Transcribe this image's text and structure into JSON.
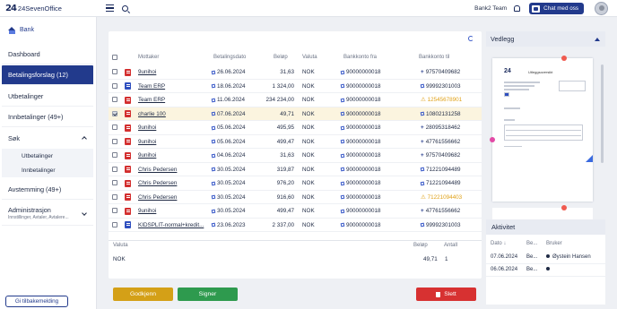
{
  "app": {
    "logo_mark": "24",
    "logo_text": "24SevenOffice"
  },
  "topbar": {
    "team": "Bank2 Team",
    "chat_label": "Chat med oss"
  },
  "sidebar": {
    "header": "Bank",
    "items": [
      {
        "label": "Dashboard"
      },
      {
        "label": "Betalingsforslag (12)"
      },
      {
        "label": "Utbetalinger"
      },
      {
        "label": "Innbetalinger (49+)"
      },
      {
        "label": "Søk"
      },
      {
        "label": "Avstemming (49+)"
      },
      {
        "label": "Administrasjon"
      }
    ],
    "sok_sub": [
      "Utbetalinger",
      "Innbetalinger"
    ],
    "admin_sub": "Innstillinger, Avtaler, Avtalere...",
    "feedback": "Gi tilbakemelding"
  },
  "table": {
    "headers": {
      "mottaker": "Mottaker",
      "dato": "Betalingsdato",
      "belop": "Beløp",
      "valuta": "Valuta",
      "fra": "Bankkonto fra",
      "til": "Bankkonto til"
    },
    "rows": [
      {
        "icon": "pdf",
        "mottaker": "9unihoi",
        "dato": "26.06.2024",
        "belop": "31,63",
        "valuta": "NOK",
        "fra": "90000000018",
        "til": "97570409682",
        "til_icon": "plus"
      },
      {
        "icon": "ehf",
        "mottaker": "Team ERP",
        "dato": "18.06.2024",
        "belop": "1 324,00",
        "valuta": "NOK",
        "fra": "90000000018",
        "til": "99992301003",
        "til_icon": "edit"
      },
      {
        "icon": "pdf",
        "mottaker": "Team ERP",
        "dato": "11.06.2024",
        "belop": "234 234,00",
        "valuta": "NOK",
        "fra": "90000000018",
        "til": "12545678901",
        "til_icon": "warn"
      },
      {
        "icon": "pdf",
        "mottaker": "charlie 100",
        "dato": "07.06.2024",
        "belop": "49,71",
        "valuta": "NOK",
        "fra": "90000000018",
        "til": "10802131258",
        "til_icon": "edit",
        "selected": true
      },
      {
        "icon": "pdf",
        "mottaker": "9unihoi",
        "dato": "05.06.2024",
        "belop": "495,95",
        "valuta": "NOK",
        "fra": "90000000018",
        "til": "28095318462",
        "til_icon": "plus"
      },
      {
        "icon": "pdf",
        "mottaker": "9unihoi",
        "dato": "05.06.2024",
        "belop": "499,47",
        "valuta": "NOK",
        "fra": "90000000018",
        "til": "47761556662",
        "til_icon": "plus"
      },
      {
        "icon": "pdf",
        "mottaker": "9unihoi",
        "dato": "04.06.2024",
        "belop": "31,63",
        "valuta": "NOK",
        "fra": "90000000018",
        "til": "97570409682",
        "til_icon": "plus"
      },
      {
        "icon": "pdf",
        "mottaker": "Chris Pedersen",
        "dato": "30.05.2024",
        "belop": "319,87",
        "valuta": "NOK",
        "fra": "90000000018",
        "til": "71221094489",
        "til_icon": "edit"
      },
      {
        "icon": "pdf",
        "mottaker": "Chris Pedersen",
        "dato": "30.05.2024",
        "belop": "976,20",
        "valuta": "NOK",
        "fra": "90000000018",
        "til": "71221094489",
        "til_icon": "edit"
      },
      {
        "icon": "pdf",
        "mottaker": "Chris Pedersen",
        "dato": "30.05.2024",
        "belop": "916,60",
        "valuta": "NOK",
        "fra": "90000000018",
        "til": "71221094403",
        "til_icon": "warn"
      },
      {
        "icon": "pdf",
        "mottaker": "9unihoi",
        "dato": "30.05.2024",
        "belop": "499,47",
        "valuta": "NOK",
        "fra": "90000000018",
        "til": "47761556662",
        "til_icon": "plus"
      },
      {
        "icon": "ehf",
        "mottaker": "KIDSPLIT-normal+kredit...",
        "dato": "23.06.2023",
        "belop": "2 337,00",
        "valuta": "NOK",
        "fra": "90000000018",
        "til": "99992301003",
        "til_icon": "edit"
      }
    ]
  },
  "summary": {
    "valuta_label": "Valuta",
    "belop_label": "Beløp",
    "antall_label": "Antall",
    "valuta": "NOK",
    "belop": "49,71",
    "antall": "1"
  },
  "actions": {
    "approve": "Godkjenn",
    "sign": "Signer",
    "delete": "Slett"
  },
  "vedlegg": {
    "title": "Vedlegg",
    "doc_title": "Utleggsoversikt",
    "doc_logo": "24"
  },
  "aktivitet": {
    "title": "Aktivitet",
    "headers": {
      "dato": "Dato",
      "be": "Be...",
      "bruker": "Bruker"
    },
    "rows": [
      {
        "dato": "07.06.2024",
        "be": "Be...",
        "bruker": "Øystein Hansen"
      },
      {
        "dato": "06.06.2024",
        "be": "Be...",
        "bruker": ""
      }
    ]
  },
  "colors": {
    "primary": "#223a8c",
    "approve": "#d4a017",
    "sign": "#2e9a4e",
    "delete": "#d73131",
    "warning": "#e0a21a"
  }
}
